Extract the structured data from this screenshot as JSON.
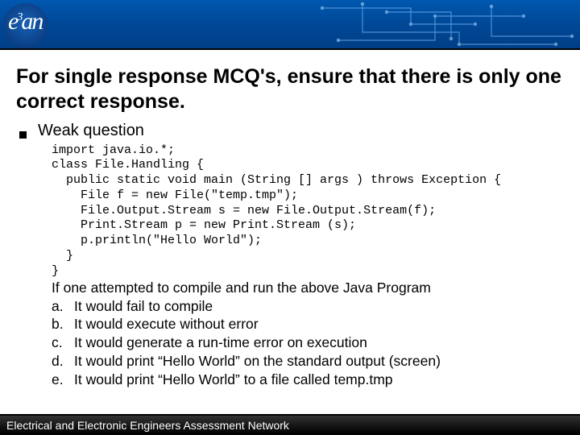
{
  "logo": {
    "text_html": "e<sup class='logo-sup'>3</sup>an"
  },
  "title": "For single response MCQ's, ensure that there is only one correct response.",
  "subhead": "Weak question",
  "code": "import java.io.*;\nclass File.Handling {\n  public static void main (String [] args ) throws Exception {\n    File f = new File(\"temp.tmp\");\n    File.Output.Stream s = new File.Output.Stream(f);\n    Print.Stream p = new Print.Stream (s);\n    p.println(\"Hello World\");\n  }\n}",
  "prompt": "If one attempted to compile and run the above Java Program",
  "options": [
    {
      "letter": "a.",
      "text": "It would fail to compile"
    },
    {
      "letter": "b.",
      "text": "It would execute without error"
    },
    {
      "letter": "c.",
      "text": "It would generate a run-time error on execution"
    },
    {
      "letter": "d.",
      "text": "It would print “Hello World” on the standard output (screen)"
    },
    {
      "letter": "e.",
      "text": "It would print “Hello World” to a file called temp.tmp"
    }
  ],
  "footer": "Electrical and Electronic Engineers Assessment Network"
}
